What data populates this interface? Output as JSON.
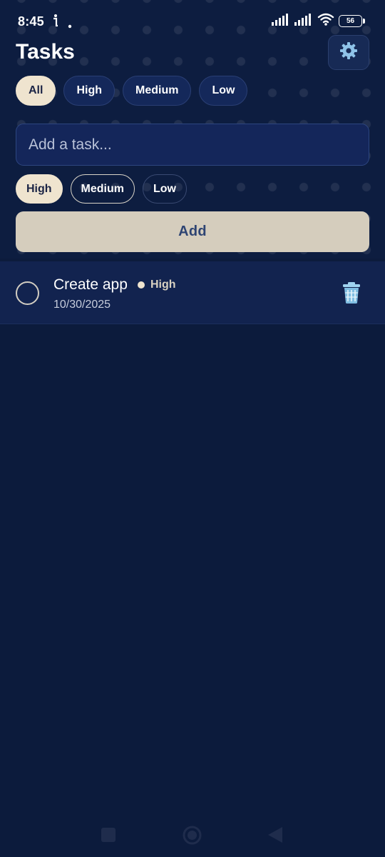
{
  "status_bar": {
    "time": "8:45",
    "battery": "56",
    "icons": [
      "info-icon",
      "dot-icon",
      "signal-icon",
      "signal-icon",
      "wifi-icon",
      "battery-icon"
    ]
  },
  "header": {
    "title": "Tasks",
    "settings_icon": "gear-icon"
  },
  "filters": {
    "items": [
      {
        "label": "All",
        "active": true
      },
      {
        "label": "High",
        "active": false
      },
      {
        "label": "Medium",
        "active": false
      },
      {
        "label": "Low",
        "active": false
      }
    ]
  },
  "new_task": {
    "placeholder": "Add a task...",
    "priorities": [
      {
        "label": "High",
        "selected": true
      },
      {
        "label": "Medium",
        "selected": false
      },
      {
        "label": "Low",
        "selected": false
      }
    ],
    "add_label": "Add"
  },
  "tasks": [
    {
      "title": "Create app",
      "priority": "High",
      "date": "10/30/2025",
      "completed": false,
      "delete_icon": "trash-icon"
    }
  ],
  "nav": {
    "icons": [
      "recents-square-icon",
      "home-circle-icon",
      "back-triangle-icon"
    ]
  },
  "colors": {
    "background": "#0c1b3c",
    "accent_cream": "#efe4cf",
    "add_button": "#d5cdbd",
    "task_row": "#12234f"
  }
}
